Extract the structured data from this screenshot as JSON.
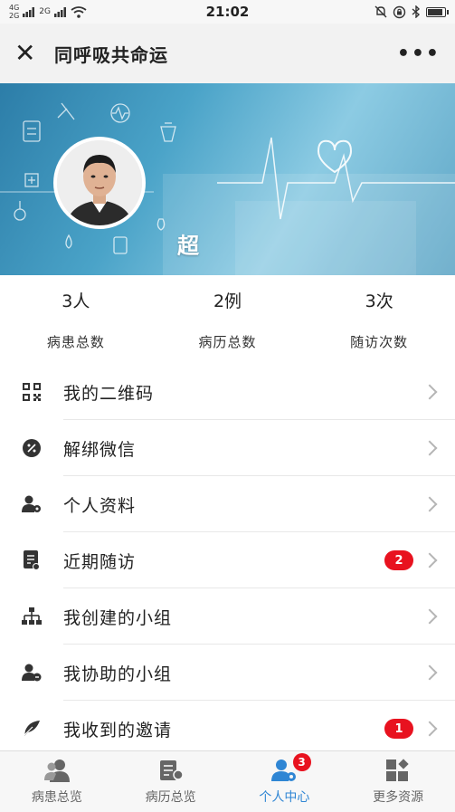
{
  "status_bar": {
    "network_top": "4G",
    "network_bottom": "2G",
    "signal_label": "2G",
    "time": "21:02"
  },
  "nav": {
    "title": "同呼吸共命运",
    "close_glyph": "✕",
    "more_glyph": "•••"
  },
  "profile": {
    "name": "超"
  },
  "stats": [
    {
      "value": "3人",
      "label": "病患总数"
    },
    {
      "value": "2例",
      "label": "病历总数"
    },
    {
      "value": "3次",
      "label": "随访次数"
    }
  ],
  "menu": [
    {
      "label": "我的二维码",
      "icon": "qr-code-icon"
    },
    {
      "label": "解绑微信",
      "icon": "unbind-icon"
    },
    {
      "label": "个人资料",
      "icon": "user-settings-icon"
    },
    {
      "label": "近期随访",
      "icon": "document-icon",
      "badge": "2"
    },
    {
      "label": "我创建的小组",
      "icon": "org-chart-icon"
    },
    {
      "label": "我协助的小组",
      "icon": "user-add-icon"
    },
    {
      "label": "我收到的邀请",
      "icon": "feather-icon",
      "badge": "1"
    }
  ],
  "tabbar": [
    {
      "label": "病患总览",
      "icon": "patients-icon"
    },
    {
      "label": "病历总览",
      "icon": "records-icon"
    },
    {
      "label": "个人中心",
      "icon": "user-center-icon",
      "badge": "3",
      "active": true
    },
    {
      "label": "更多资源",
      "icon": "resources-icon"
    }
  ],
  "colors": {
    "accent": "#2f86d4",
    "badge": "#e8121f"
  }
}
